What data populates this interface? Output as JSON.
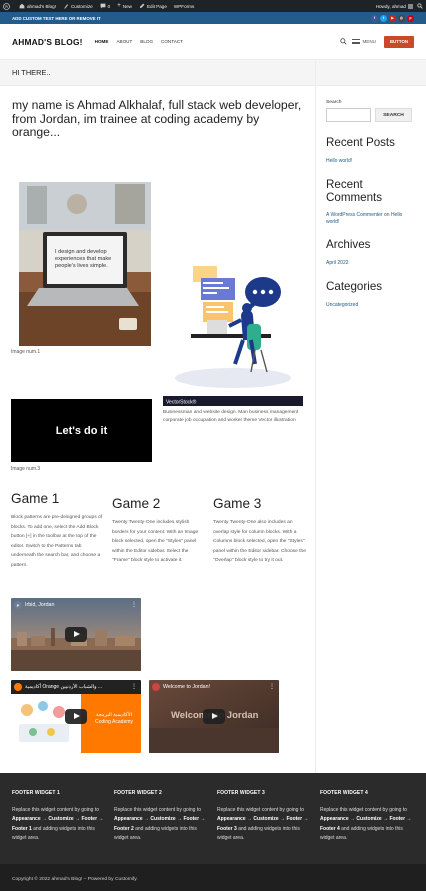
{
  "admin_bar": {
    "site_name": "ahmad's Blog!",
    "customize": "Customize",
    "comments_count": "0",
    "new": "New",
    "edit_page": "Edit Page",
    "wpforms": "WPForms",
    "howdy": "Howdy, ahmad"
  },
  "top_bar": {
    "text": "ADD CUSTOM TEXT HERE OR REMOVE IT",
    "social_icons": [
      "facebook-icon",
      "twitter-icon",
      "youtube-icon",
      "instagram-icon",
      "pinterest-icon"
    ],
    "social_colors": [
      "#3b5998",
      "#1da1f2",
      "#cd201f",
      "#444444",
      "#bd081c"
    ]
  },
  "header": {
    "logo": "AHMAD'S BLOG!",
    "nav": [
      "HOME",
      "ABOUT",
      "BLOG",
      "CONTACT"
    ],
    "menu_label": "MENU",
    "button_label": "BUTTON",
    "button_color": "#c94a2b"
  },
  "page_title": "HI THERE..",
  "intro": "my name is Ahmad Alkhalaf, full stack web developer, from Jordan, im trainee at coding academy by orange...",
  "images": {
    "img1_screen_text": "I design and develop experiences that make people's lives simple.",
    "img1_caption": "Image num.1",
    "img2_brand": "VectorStock®",
    "img2_caption": "Businessman and website design. Man business management corporate job occupation and worker theme Vector illustration",
    "img3_text": "Let's do it",
    "img3_caption": "Image num.3"
  },
  "games": [
    {
      "title": "Game 1",
      "text": "Block patterns are pre-designed groups of blocks. To add one, select the Add Block button [+] in the toolbar at the top of the editor. Switch to the Patterns tab underneath the search bar, and choose a pattern."
    },
    {
      "title": "Game 2",
      "text": "Twenty Twenty-One includes stylish borders for your content. With an Image block selected, open the \"Styles\" panel within the Editor sidebar. Select the \"Frame\" block style to activate it."
    },
    {
      "title": "Game 3",
      "text": "Twenty Twenty-One also includes an overlap style for column blocks. With a Columns block selected, open the \"Styles\" panel within the Editor sidebar. Choose the \"Overlap\" block style to try it out."
    }
  ],
  "videos": [
    {
      "title": "Irbid, Jordan",
      "avatar": "P"
    },
    {
      "title": "أكاديمية Orange والشباب الأردنيين ...",
      "overlay": "الأكاديمية البرمجة",
      "overlay2": "Coding Academy"
    },
    {
      "title": "Welcome to Jordan!",
      "overlay": "Welcome to Jordan"
    }
  ],
  "sidebar": {
    "search_label": "Search",
    "search_button": "SEARCH",
    "recent_posts_title": "Recent Posts",
    "recent_post": "Hello world!",
    "recent_comments_title": "Recent Comments",
    "commenter": "A WordPress Commenter",
    "comment_on": "on",
    "comment_post": "Hello world!",
    "archives_title": "Archives",
    "archive": "April 2022",
    "categories_title": "Categories",
    "category": "Uncategorized"
  },
  "footer": {
    "widgets": [
      {
        "title": "FOOTER WIDGET 1",
        "target": "Footer 1"
      },
      {
        "title": "FOOTER WIDGET 2",
        "target": "Footer 2"
      },
      {
        "title": "FOOTER WIDGET 3",
        "target": "Footer 3"
      },
      {
        "title": "FOOTER WIDGET 4",
        "target": "Footer 4"
      }
    ],
    "replace_text": "Replace this widget content by going to",
    "appearance": "Appearance",
    "path": "Customize → Footer →",
    "end_text": "and adding widgets into this widget area.",
    "copyright": "Copyright © 2022 ahmad's Blog! – Powered by",
    "powered_link": "Customify."
  },
  "colors": {
    "admin_bar": "#1d2327",
    "top_bar": "#235b8a",
    "link": "#235b8a",
    "footer": "#2b2b2b",
    "copyright": "#1f1f1f"
  }
}
